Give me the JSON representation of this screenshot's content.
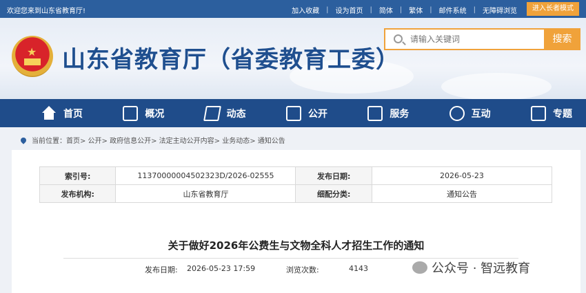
{
  "topbar": {
    "welcome": "欢迎您来到山东省教育厅!",
    "links": [
      "加入收藏",
      "设为首页",
      "简体",
      "繁体",
      "邮件系统",
      "无障碍浏览"
    ],
    "elder_mode": "进入长者模式"
  },
  "header": {
    "site_title": "山东省教育厅（省委教育工委）"
  },
  "search": {
    "placeholder": "请输入关键词",
    "button": "搜索"
  },
  "nav": {
    "items": [
      {
        "label": "首页",
        "icon": "home-icon"
      },
      {
        "label": "概况",
        "icon": "overview-icon"
      },
      {
        "label": "动态",
        "icon": "layers-icon"
      },
      {
        "label": "公开",
        "icon": "book-icon"
      },
      {
        "label": "服务",
        "icon": "service-icon"
      },
      {
        "label": "互动",
        "icon": "chat-icon"
      },
      {
        "label": "专题",
        "icon": "topic-icon"
      }
    ]
  },
  "breadcrumb": {
    "prefix": "当前位置：",
    "path": "首页> 公开> 政府信息公开> 法定主动公开内容> 业务动态> 通知公告"
  },
  "meta": {
    "index_label": "索引号:",
    "index_value": "11370000004502323D/2026-02555",
    "pubdate_label": "发布日期:",
    "pubdate_value": "2026-05-23",
    "org_label": "发布机构:",
    "org_value": "山东省教育厅",
    "category_label": "细配分类:",
    "category_value": "通知公告"
  },
  "article": {
    "title": "关于做好2026年公费生与文物全科人才招生工作的通知",
    "pubtime_label": "发布日期:",
    "pubtime_value": "2026-05-23 17:59",
    "views_label": "浏览次数:",
    "views_value": "4143"
  },
  "watermark": {
    "text": "公众号 · 智远教育"
  }
}
